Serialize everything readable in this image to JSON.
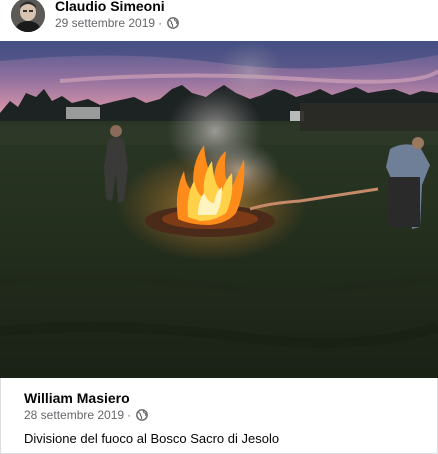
{
  "post": {
    "author": "Claudio Simeoni",
    "date": "29 settembre 2019",
    "separator": "·",
    "privacy_icon": "globe-icon"
  },
  "photo": {
    "subject": "bonfire-in-field-at-dusk"
  },
  "shared": {
    "author": "William Masiero",
    "date": "28 settembre 2019",
    "separator": "·",
    "privacy_icon": "globe-icon",
    "text": "Divisione del fuoco al Bosco Sacro di Jesolo"
  },
  "colors": {
    "name_text": "#050505",
    "secondary_text": "#65676b",
    "border": "#dadde1"
  }
}
